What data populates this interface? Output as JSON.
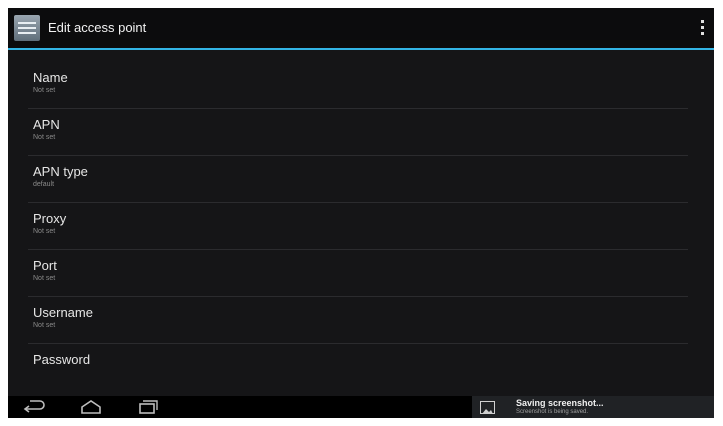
{
  "header": {
    "title": "Edit access point"
  },
  "fields": [
    {
      "label": "Name",
      "value": "Not set"
    },
    {
      "label": "APN",
      "value": "Not set"
    },
    {
      "label": "APN type",
      "value": "default"
    },
    {
      "label": "Proxy",
      "value": "Not set"
    },
    {
      "label": "Port",
      "value": "Not set"
    },
    {
      "label": "Username",
      "value": "Not set"
    },
    {
      "label": "Password",
      "value": ""
    }
  ],
  "notification": {
    "title": "Saving screenshot...",
    "subtitle": "Screenshot is being saved."
  },
  "colors": {
    "accent": "#33b5e5",
    "background": "#151517"
  },
  "icons": [
    "settings-app-icon",
    "overflow-menu-icon",
    "back-icon",
    "home-icon",
    "recents-icon",
    "image-icon"
  ]
}
